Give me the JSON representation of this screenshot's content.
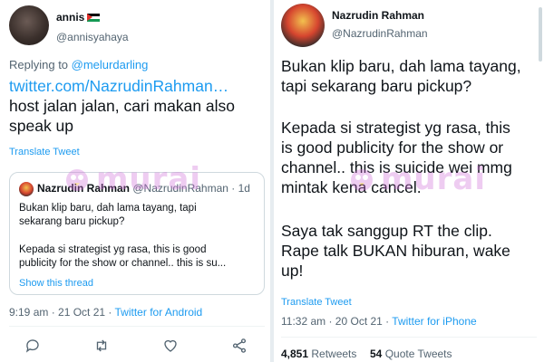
{
  "left_tweet": {
    "author_name": "annis",
    "author_handle": "@annisyahaya",
    "replying_prefix": "Replying to ",
    "replying_to": "@melurdarling",
    "body_link": "twitter.com/NazrudinRahman…",
    "body_text_1": "host jalan jalan, cari makan also",
    "body_text_2": "speak up",
    "translate": "Translate Tweet",
    "quote": {
      "author_name": "Nazrudin Rahman",
      "author_handle": "@NazrudinRahman · 1d",
      "line_1": "Bukan klip baru, dah lama tayang, tapi",
      "line_2": "sekarang baru pickup?",
      "line_3": "Kepada si strategist yg rasa, this is good",
      "line_4": "publicity for the show or channel.. this is su...",
      "show_thread": "Show this thread"
    },
    "time": "9:19 am · 21 Oct 21 · ",
    "source": "Twitter for Android"
  },
  "right_tweet": {
    "author_name": "Nazrudin Rahman",
    "author_handle": "@NazrudinRahman",
    "lines": [
      "Bukan klip baru, dah lama tayang,",
      "tapi sekarang baru pickup?",
      "Kepada si strategist yg rasa, this",
      "is good publicity for the show or",
      "channel.. this is suicide wei mmg",
      "mintak kena cancel.",
      "Saya tak sanggup RT the clip.",
      "Rape talk BUKAN hiburan, wake",
      "up!"
    ],
    "translate": "Translate Tweet",
    "time": "11:32 am · 20 Oct 21 · ",
    "source": "Twitter for iPhone",
    "retweets_count": "4,851",
    "retweets_label": " Retweets",
    "quotes_count": "54",
    "quotes_label": " Quote Tweets"
  },
  "watermark": "murai",
  "colors": {
    "link": "#1d9bf0",
    "secondary_text": "#536471",
    "primary_text": "#0f1419",
    "border": "#cfd9de",
    "watermark": "#d16fd8"
  },
  "icons": [
    "reply-icon",
    "retweet-icon",
    "like-icon",
    "share-icon"
  ]
}
